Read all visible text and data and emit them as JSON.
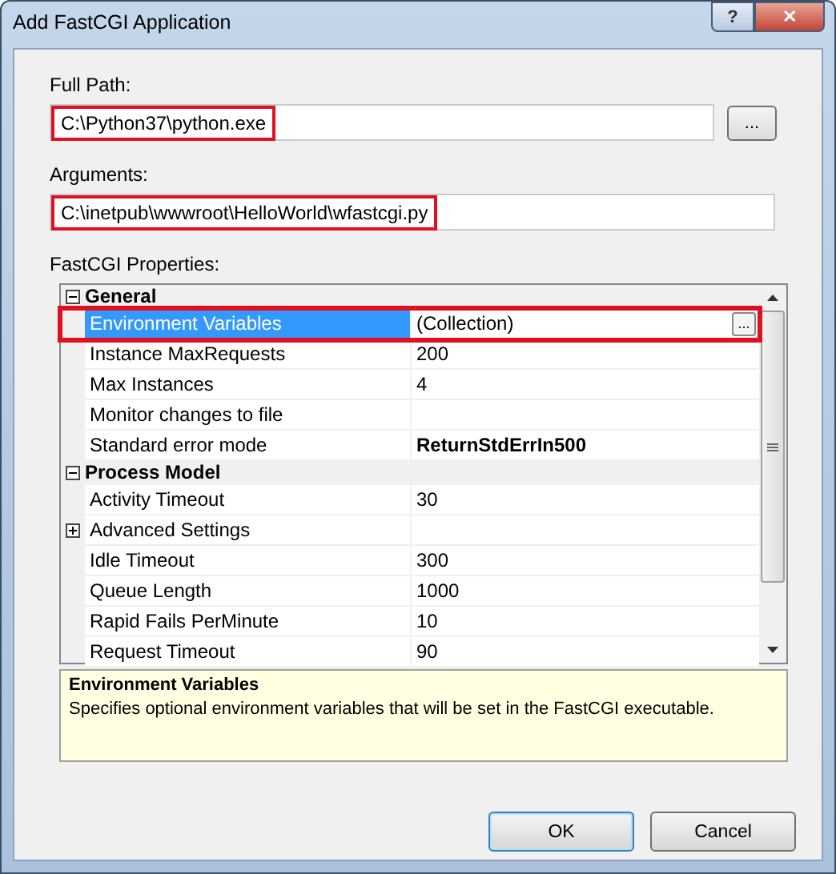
{
  "window": {
    "title": "Add FastCGI Application",
    "help_button": "?",
    "close_button": "✕"
  },
  "full_path": {
    "label": "Full Path:",
    "value": "C:\\Python37\\python.exe",
    "highlighted": true,
    "browse_button": "..."
  },
  "arguments": {
    "label": "Arguments:",
    "value": "C:\\inetpub\\wwwroot\\HelloWorld\\wfastcgi.py",
    "highlighted": true
  },
  "properties": {
    "label": "FastCGI Properties:",
    "rows": [
      {
        "kind": "category",
        "name": "General",
        "expanded": true
      },
      {
        "kind": "property",
        "name": "Environment Variables",
        "value": "(Collection)",
        "selected": true,
        "highlighted": true,
        "edit_button": "..."
      },
      {
        "kind": "property",
        "name": "Instance MaxRequests",
        "value": "200",
        "selected": false
      },
      {
        "kind": "property",
        "name": "Max Instances",
        "value": "4",
        "selected": false
      },
      {
        "kind": "property",
        "name": "Monitor changes to file",
        "selected": false
      },
      {
        "kind": "property",
        "name": "Standard error mode",
        "value": "ReturnStdErrIn500",
        "selected": false,
        "bold": true
      },
      {
        "kind": "category",
        "name": "Process Model",
        "expanded": true
      },
      {
        "kind": "property",
        "name": "Activity Timeout",
        "value": "30",
        "selected": false
      },
      {
        "kind": "expandable",
        "name": "Advanced Settings",
        "expanded": false,
        "selected": false
      },
      {
        "kind": "property",
        "name": "Idle Timeout",
        "value": "300",
        "selected": false
      },
      {
        "kind": "property",
        "name": "Queue Length",
        "value": "1000",
        "selected": false
      },
      {
        "kind": "property",
        "name": "Rapid Fails PerMinute",
        "value": "10",
        "selected": false
      },
      {
        "kind": "property",
        "name": "Request Timeout",
        "value": "90",
        "selected": false
      }
    ]
  },
  "description": {
    "title": "Environment Variables",
    "text": "Specifies optional environment variables that will be set in the FastCGI executable."
  },
  "buttons": [
    {
      "label": "OK",
      "default": true
    },
    {
      "label": "Cancel",
      "default": false
    }
  ]
}
